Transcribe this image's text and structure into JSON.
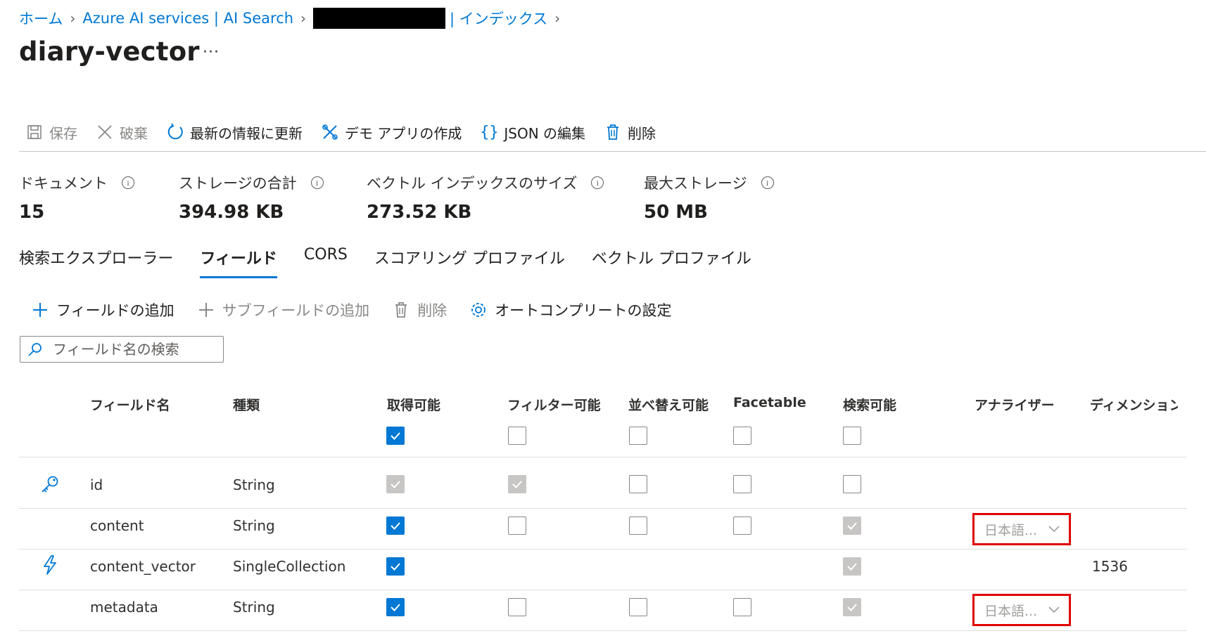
{
  "breadcrumb": {
    "items": [
      "ホーム",
      "Azure AI services | AI Search",
      "| インデックス"
    ]
  },
  "page": {
    "title": "diary-vector",
    "more": "···"
  },
  "toolbar": {
    "save": "保存",
    "discard": "破棄",
    "refresh": "最新の情報に更新",
    "demo_app": "デモ アプリの作成",
    "edit_json": "JSON の編集",
    "delete": "削除"
  },
  "stats": [
    {
      "label": "ドキュメント",
      "value": "15"
    },
    {
      "label": "ストレージの合計",
      "value": "394.98 KB"
    },
    {
      "label": "ベクトル インデックスのサイズ",
      "value": "273.52 KB"
    },
    {
      "label": "最大ストレージ",
      "value": "50 MB"
    }
  ],
  "tabs": [
    "検索エクスプローラー",
    "フィールド",
    "CORS",
    "スコアリング プロファイル",
    "ベクトル プロファイル"
  ],
  "active_tab": "フィールド",
  "field_toolbar": {
    "add_field": "フィールドの追加",
    "add_subfield": "サブフィールドの追加",
    "delete": "削除",
    "autocomplete": "オートコンプリートの設定"
  },
  "search": {
    "placeholder": "フィールド名の検索"
  },
  "table": {
    "headers": {
      "name": "フィールド名",
      "type": "種類",
      "retrievable": "取得可能",
      "filterable": "フィルター可能",
      "sortable": "並べ替え可能",
      "facetable": "Facetable",
      "searchable": "検索可能",
      "analyzer": "アナライザー",
      "dimension": "ディメンション"
    },
    "rows": [
      {
        "icon": "key-icon",
        "name": "id",
        "type": "String",
        "dimension": ""
      },
      {
        "icon": "",
        "name": "content",
        "type": "String",
        "analyzer": "日本語...",
        "dimension": ""
      },
      {
        "icon": "lightning-icon",
        "name": "content_vector",
        "type": "SingleCollection",
        "dimension": "1536"
      },
      {
        "icon": "",
        "name": "metadata",
        "type": "String",
        "analyzer": "日本語...",
        "dimension": ""
      }
    ]
  },
  "colors": {
    "accent": "#0078d4",
    "highlight_border": "#e00000",
    "disabled_check": "#c8c6c4"
  }
}
